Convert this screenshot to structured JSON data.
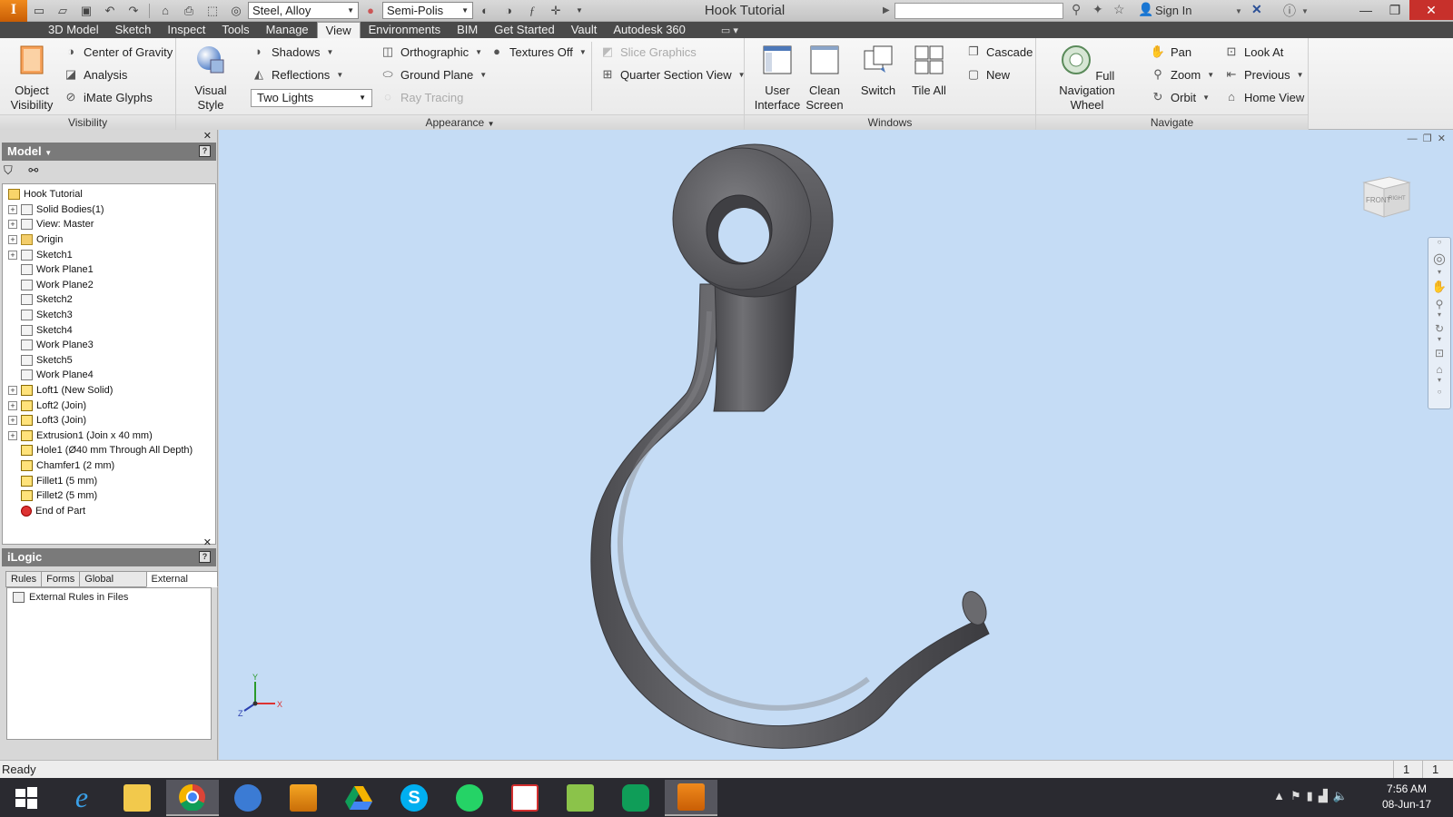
{
  "app": {
    "logo_letter": "I",
    "window_title": "Hook Tutorial",
    "material": "Steel, Alloy",
    "appearance": "Semi-Polis",
    "sign_in": "Sign In"
  },
  "menu": {
    "tabs": [
      "3D Model",
      "Sketch",
      "Inspect",
      "Tools",
      "Manage",
      "View",
      "Environments",
      "BIM",
      "Get Started",
      "Vault",
      "Autodesk 360"
    ],
    "active_tab": "View"
  },
  "ribbon": {
    "visibility": {
      "title": "Visibility",
      "object_visibility": "Object Visibility",
      "center_of_gravity": "Center of Gravity",
      "analysis": "Analysis",
      "imate_glyphs": "iMate Glyphs"
    },
    "appearance": {
      "title": "Appearance",
      "visual_style": "Visual Style",
      "shadows": "Shadows",
      "reflections": "Reflections",
      "lighting": "Two Lights",
      "orthographic": "Orthographic",
      "ground_plane": "Ground Plane",
      "ray_tracing": "Ray Tracing",
      "textures_off": "Textures Off",
      "slice_graphics": "Slice Graphics",
      "quarter_section_view": "Quarter Section View"
    },
    "windows": {
      "title": "Windows",
      "user_interface": "User Interface",
      "clean_screen": "Clean Screen",
      "switch": "Switch",
      "tile_all": "Tile All",
      "cascade": "Cascade",
      "new": "New"
    },
    "navigate": {
      "title": "Navigate",
      "full_navigation_wheel": "Full Navigation Wheel",
      "pan": "Pan",
      "zoom": "Zoom",
      "orbit": "Orbit",
      "look_at": "Look At",
      "previous": "Previous",
      "home_view": "Home View"
    }
  },
  "browser": {
    "title": "Model",
    "items": [
      {
        "label": "Hook Tutorial",
        "icon": "part-icon",
        "expand": false
      },
      {
        "label": "Solid Bodies(1)",
        "icon": "solid-bodies-icon",
        "expand": true
      },
      {
        "label": "View: Master",
        "icon": "view-icon",
        "expand": true
      },
      {
        "label": "Origin",
        "icon": "folder-icon",
        "expand": true
      },
      {
        "label": "Sketch1",
        "icon": "sketch-icon",
        "expand": true
      },
      {
        "label": "Work Plane1",
        "icon": "workplane-icon",
        "expand": false
      },
      {
        "label": "Work Plane2",
        "icon": "workplane-icon",
        "expand": false
      },
      {
        "label": "Sketch2",
        "icon": "sketch-icon",
        "expand": false
      },
      {
        "label": "Sketch3",
        "icon": "sketch-icon",
        "expand": false
      },
      {
        "label": "Sketch4",
        "icon": "sketch-icon",
        "expand": false
      },
      {
        "label": "Work Plane3",
        "icon": "workplane-icon",
        "expand": false
      },
      {
        "label": "Sketch5",
        "icon": "sketch-icon",
        "expand": false
      },
      {
        "label": "Work Plane4",
        "icon": "workplane-icon",
        "expand": false
      },
      {
        "label": "Loft1 (New Solid)",
        "icon": "loft-icon",
        "expand": true
      },
      {
        "label": "Loft2 (Join)",
        "icon": "loft-icon",
        "expand": true
      },
      {
        "label": "Loft3 (Join)",
        "icon": "loft-icon",
        "expand": true
      },
      {
        "label": "Extrusion1 (Join x 40 mm)",
        "icon": "extrude-icon",
        "expand": true
      },
      {
        "label": "Hole1 (Ø40 mm Through All Depth)",
        "icon": "hole-icon",
        "expand": false
      },
      {
        "label": "Chamfer1 (2 mm)",
        "icon": "chamfer-icon",
        "expand": false
      },
      {
        "label": "Fillet1 (5 mm)",
        "icon": "fillet-icon",
        "expand": false
      },
      {
        "label": "Fillet2 (5 mm)",
        "icon": "fillet-icon",
        "expand": false
      },
      {
        "label": "End of Part",
        "icon": "end-of-part-icon",
        "expand": false
      }
    ]
  },
  "ilogic": {
    "title": "iLogic",
    "tabs": [
      "Rules",
      "Forms",
      "Global Forms",
      "External Rules"
    ],
    "active_tab": "External Rules",
    "content_item": "External Rules in Files"
  },
  "viewcube": {
    "front": "FRONT",
    "right": "RIGHT"
  },
  "triad": {
    "x": "X",
    "y": "Y",
    "z": "Z"
  },
  "status": {
    "text": "Ready",
    "num1": "1",
    "num2": "1"
  },
  "taskbar": {
    "apps": [
      "windows-start",
      "internet-explorer",
      "file-explorer",
      "chrome",
      "network-app",
      "autodesk-suite",
      "google-drive",
      "skype",
      "whatsapp",
      "acrobat-reader",
      "document-editor",
      "hangouts",
      "inventor-pro"
    ],
    "active_app": "inventor-pro",
    "time": "7:56 AM",
    "date": "08-Jun-17"
  },
  "colors": {
    "viewport_bg": "#c5dcf5",
    "hook_metal": "#5a5a5e",
    "menu_bg": "#4a4a4a",
    "inventor_orange": "#e27614"
  }
}
